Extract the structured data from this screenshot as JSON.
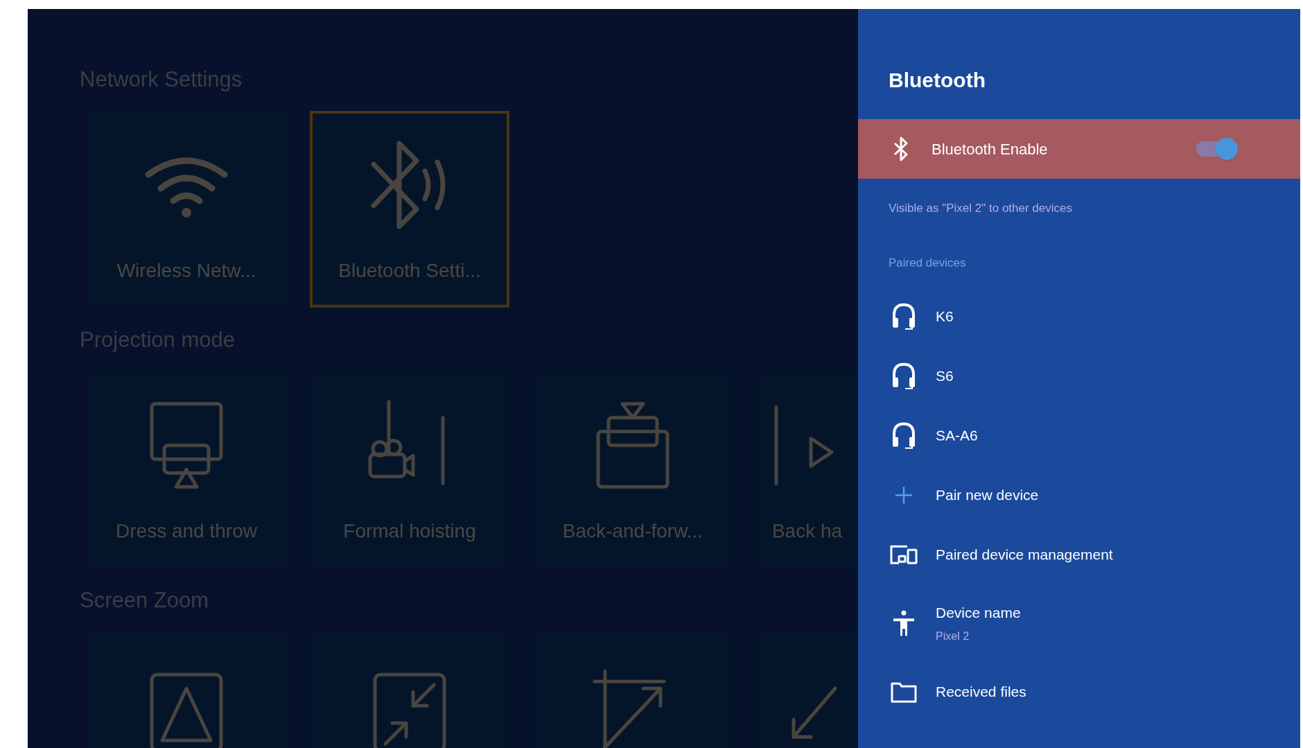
{
  "sections": [
    {
      "heading": "Network Settings",
      "tiles": [
        {
          "kind": "wifi",
          "label": "Wireless Netw...",
          "selected": false
        },
        {
          "kind": "bluetooth",
          "label": "Bluetooth Setti...",
          "selected": true
        }
      ]
    },
    {
      "heading": "Projection mode",
      "tiles": [
        {
          "kind": "front",
          "label": "Dress and throw",
          "selected": false
        },
        {
          "kind": "ceiling",
          "label": "Formal hoisting",
          "selected": false
        },
        {
          "kind": "rear",
          "label": "Back-and-forw...",
          "selected": false
        },
        {
          "kind": "rearceiling",
          "label": "Back ha",
          "selected": false
        }
      ]
    },
    {
      "heading": "Screen Zoom",
      "tiles": [
        {
          "kind": "keystone",
          "selected": false
        },
        {
          "kind": "shrink",
          "selected": false
        },
        {
          "kind": "expand",
          "selected": false
        },
        {
          "kind": "arrow",
          "selected": false
        }
      ]
    }
  ],
  "panel": {
    "title": "Bluetooth",
    "enable": {
      "label": "Bluetooth Enable",
      "on": true,
      "focused": true
    },
    "visibility": "Visible as \"Pixel 2\" to other devices",
    "paired_heading": "Paired devices",
    "items": [
      {
        "kind": "headset",
        "label": "K6"
      },
      {
        "kind": "headset",
        "label": "S6"
      },
      {
        "kind": "headset",
        "label": "SA-A6"
      },
      {
        "kind": "add",
        "label": "Pair new device"
      },
      {
        "kind": "manage",
        "label": "Paired device management"
      },
      {
        "kind": "name",
        "label": "Device name",
        "subtitle": "Pixel 2"
      },
      {
        "kind": "folder",
        "label": "Received files"
      }
    ]
  }
}
